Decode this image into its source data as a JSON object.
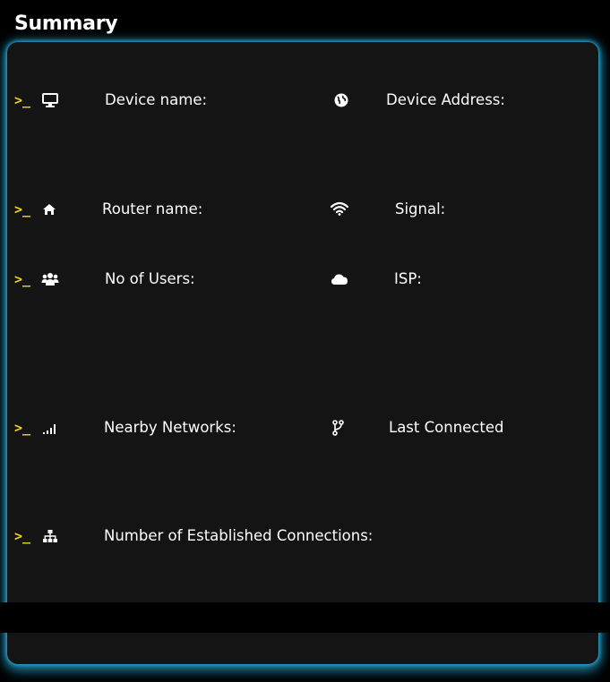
{
  "header": {
    "title": "Summary"
  },
  "theme": {
    "background": "#000000",
    "card_background": "#141414",
    "glow_color": "#2aa9d6",
    "prompt_color": "#f2d21b",
    "text_color": "#ffffff"
  },
  "prompt_symbol": ">_",
  "rows": [
    {
      "left": {
        "icon": "desktop-icon",
        "label": "Device name:"
      },
      "right": {
        "icon": "globe-icon",
        "label": "Device Address:"
      }
    },
    {
      "left": {
        "icon": "home-icon",
        "label": "Router name:"
      },
      "right": {
        "icon": "wifi-icon",
        "label": "Signal:"
      }
    },
    {
      "left": {
        "icon": "users-icon",
        "label": "No of Users:"
      },
      "right": {
        "icon": "cloud-icon",
        "label": "ISP:"
      }
    },
    {
      "left": {
        "icon": "signal-bars-icon",
        "label": "Nearby Networks:"
      },
      "right": {
        "icon": "branch-icon",
        "label": "Last Connected"
      }
    },
    {
      "left": {
        "icon": "sitemap-icon",
        "label": "Number of Established Connections:"
      }
    }
  ]
}
